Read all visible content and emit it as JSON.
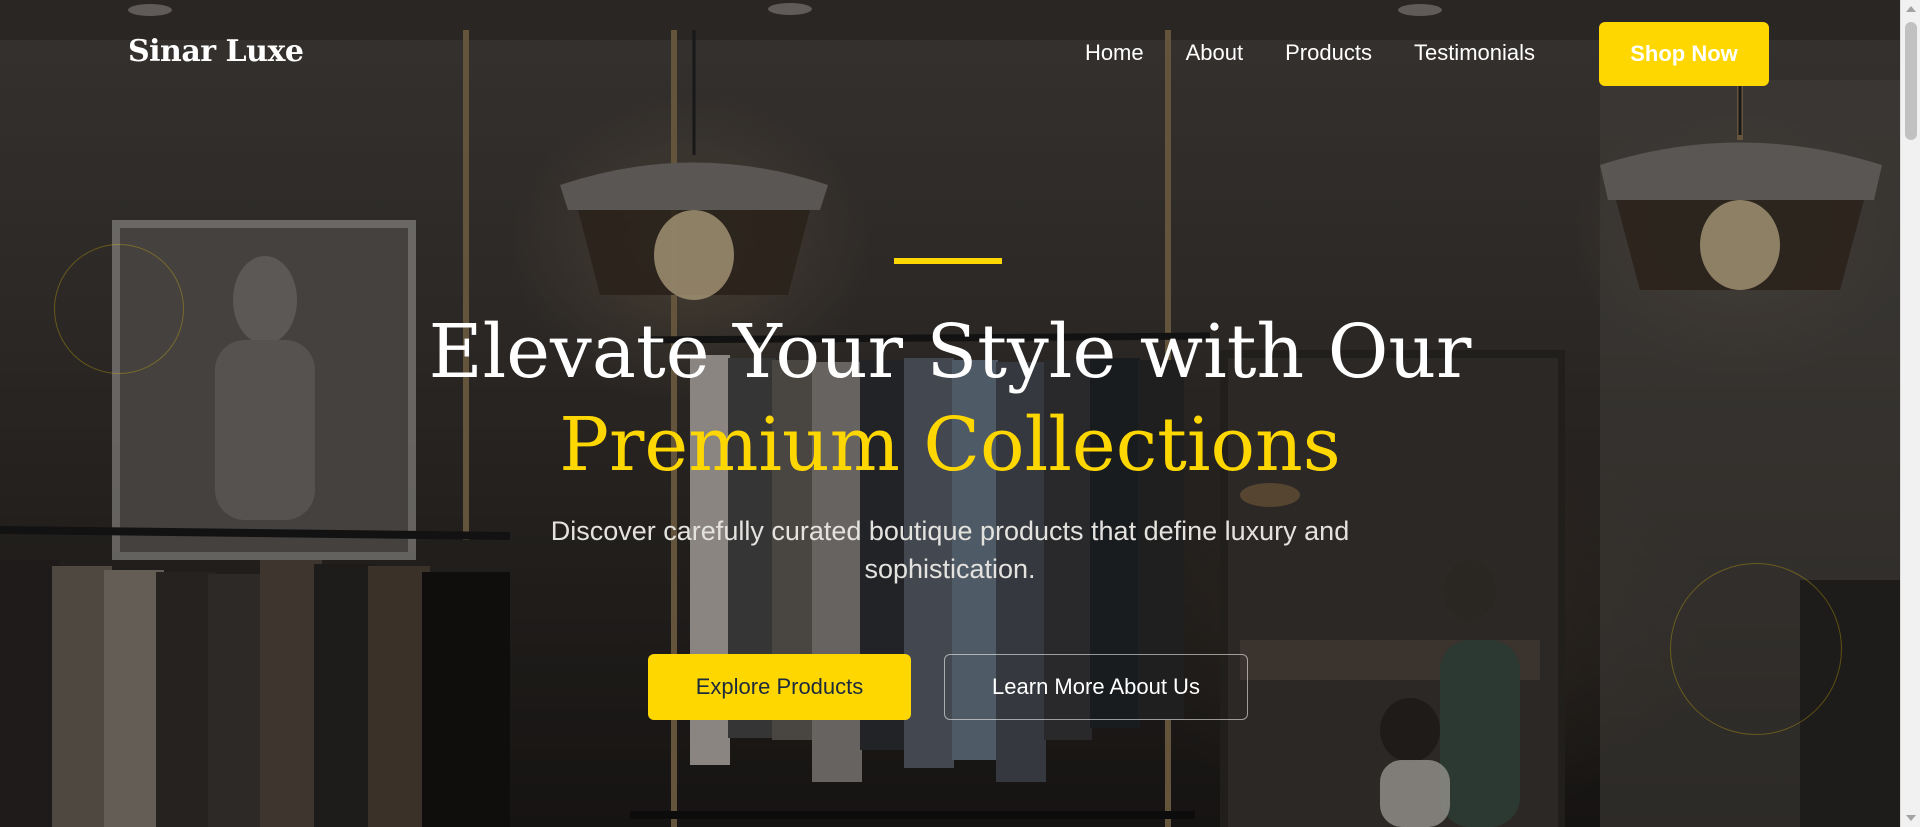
{
  "brand": {
    "logo": "Sinar Luxe"
  },
  "nav": {
    "links": [
      "Home",
      "About",
      "Products",
      "Testimonials"
    ],
    "cta": "Shop Now"
  },
  "hero": {
    "headline_line1": "Elevate Your Style with Our",
    "headline_line2": "Premium Collections",
    "subtext": "Discover carefully curated boutique products that define luxury and sophistication.",
    "primary_button": "Explore Products",
    "secondary_button": "Learn More About Us"
  },
  "colors": {
    "accent": "#ffd700",
    "primary_button_text": "#1c2a3d",
    "text": "#ffffff"
  },
  "icons": [
    "scroll-up-arrow-icon",
    "scroll-down-arrow-icon"
  ]
}
